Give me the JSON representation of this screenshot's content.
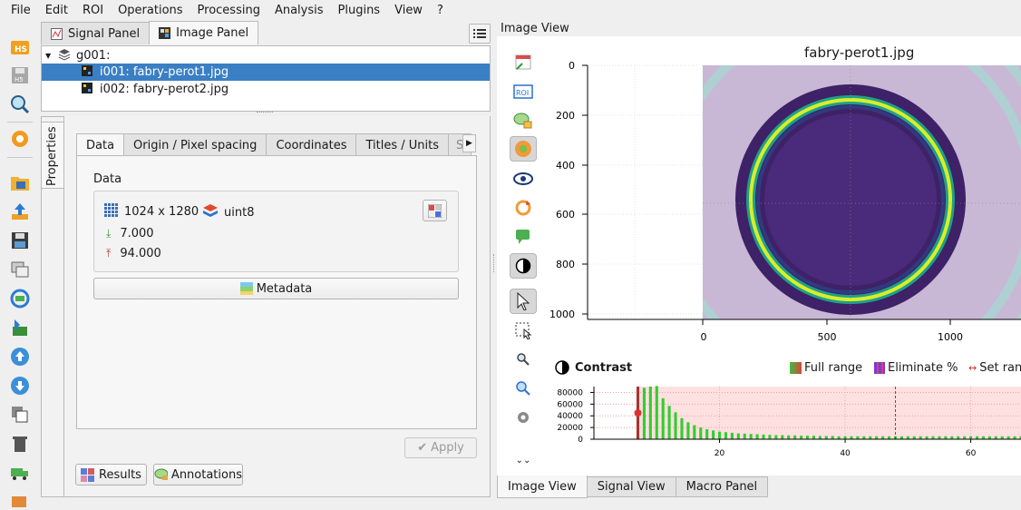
{
  "menu": [
    "File",
    "Edit",
    "ROI",
    "Operations",
    "Processing",
    "Analysis",
    "Plugins",
    "View",
    "?"
  ],
  "left_toolbar": {
    "icons": [
      "open-h5-icon",
      "save-h5-icon",
      "browse-h5-icon",
      "settings-icon",
      "open-file-icon",
      "import-icon",
      "save-file-icon",
      "duplicate-icon",
      "refresh-icon",
      "add-plugin-icon",
      "move-up-icon",
      "move-down-icon",
      "copy-icon",
      "delete-icon",
      "truck-icon",
      "extra-icon"
    ]
  },
  "panel_tabs": [
    {
      "label": "Signal Panel",
      "active": false
    },
    {
      "label": "Image Panel",
      "active": true
    }
  ],
  "tree": {
    "group": "g001:",
    "items": [
      {
        "label": "i001: fabry-perot1.jpg",
        "selected": true
      },
      {
        "label": "i002: fabry-perot2.jpg",
        "selected": false
      }
    ]
  },
  "properties": {
    "vertical_tab": "Properties",
    "subtabs": [
      "Data",
      "Origin / Pixel spacing",
      "Coordinates",
      "Titles / Units",
      "S"
    ],
    "group_title": "Data",
    "size": "1024 x 1280",
    "dtype": "uint8",
    "min": "7.000",
    "max": "94.000",
    "metadata_label": "Metadata",
    "apply_label": "Apply",
    "results_label": "Results",
    "annotations_label": "Annotations"
  },
  "image_view": {
    "title": "Image View",
    "plot_title": "fabry-perot1.jpg",
    "y_ticks": [
      "0",
      "200",
      "400",
      "600",
      "800",
      "1000"
    ],
    "x_ticks": [
      "0",
      "500",
      "1000"
    ],
    "contrast": {
      "title": "Contrast",
      "full_range": "Full range",
      "eliminate": "Eliminate %",
      "set_range": "Set ran"
    }
  },
  "chart_data": {
    "type": "bar",
    "title": "",
    "xlabel": "",
    "ylabel": "",
    "x_ticks": [
      20,
      40,
      60
    ],
    "y_ticks": [
      0,
      20000,
      40000,
      60000,
      80000
    ],
    "xlim": [
      0,
      68
    ],
    "ylim": [
      0,
      90000
    ],
    "x": [
      7,
      8,
      9,
      10,
      11,
      12,
      13,
      14,
      15,
      16,
      17,
      18,
      19,
      20,
      21,
      22,
      23,
      24,
      25,
      26,
      27,
      28,
      29,
      30,
      31,
      32,
      33,
      34,
      35,
      36,
      37,
      38,
      39,
      40,
      41,
      42,
      43,
      44,
      45,
      46,
      47,
      48,
      49,
      50,
      51,
      52,
      53,
      54,
      55,
      56,
      57,
      58,
      59,
      60,
      61,
      62,
      63,
      64,
      65,
      66,
      67,
      68
    ],
    "values": [
      90000,
      88000,
      90000,
      91000,
      70000,
      57000,
      46000,
      36000,
      29000,
      24000,
      20000,
      17000,
      15000,
      13000,
      12000,
      11000,
      10000,
      9500,
      9000,
      8500,
      8000,
      7500,
      7000,
      7000,
      6500,
      6500,
      6000,
      6000,
      6000,
      5500,
      5500,
      5500,
      5000,
      5000,
      5000,
      5000,
      5000,
      5000,
      5000,
      5000,
      5000,
      5000,
      5000,
      5000,
      5000,
      5000,
      5000,
      5000,
      5000,
      5000,
      5000,
      5000,
      5000,
      5000,
      5000,
      5000,
      5000,
      5000,
      5000,
      5000,
      5000,
      5000
    ],
    "range_min": 7,
    "range_max": 94
  },
  "bottom_tabs": [
    {
      "label": "Image View",
      "active": true
    },
    {
      "label": "Signal View",
      "active": false
    },
    {
      "label": "Macro Panel",
      "active": false
    }
  ],
  "colors": {
    "selection": "#3a7fc4",
    "hist_bar": "#33cc33",
    "range_fill": "#ffe0e0",
    "range_line": "#b03030"
  }
}
